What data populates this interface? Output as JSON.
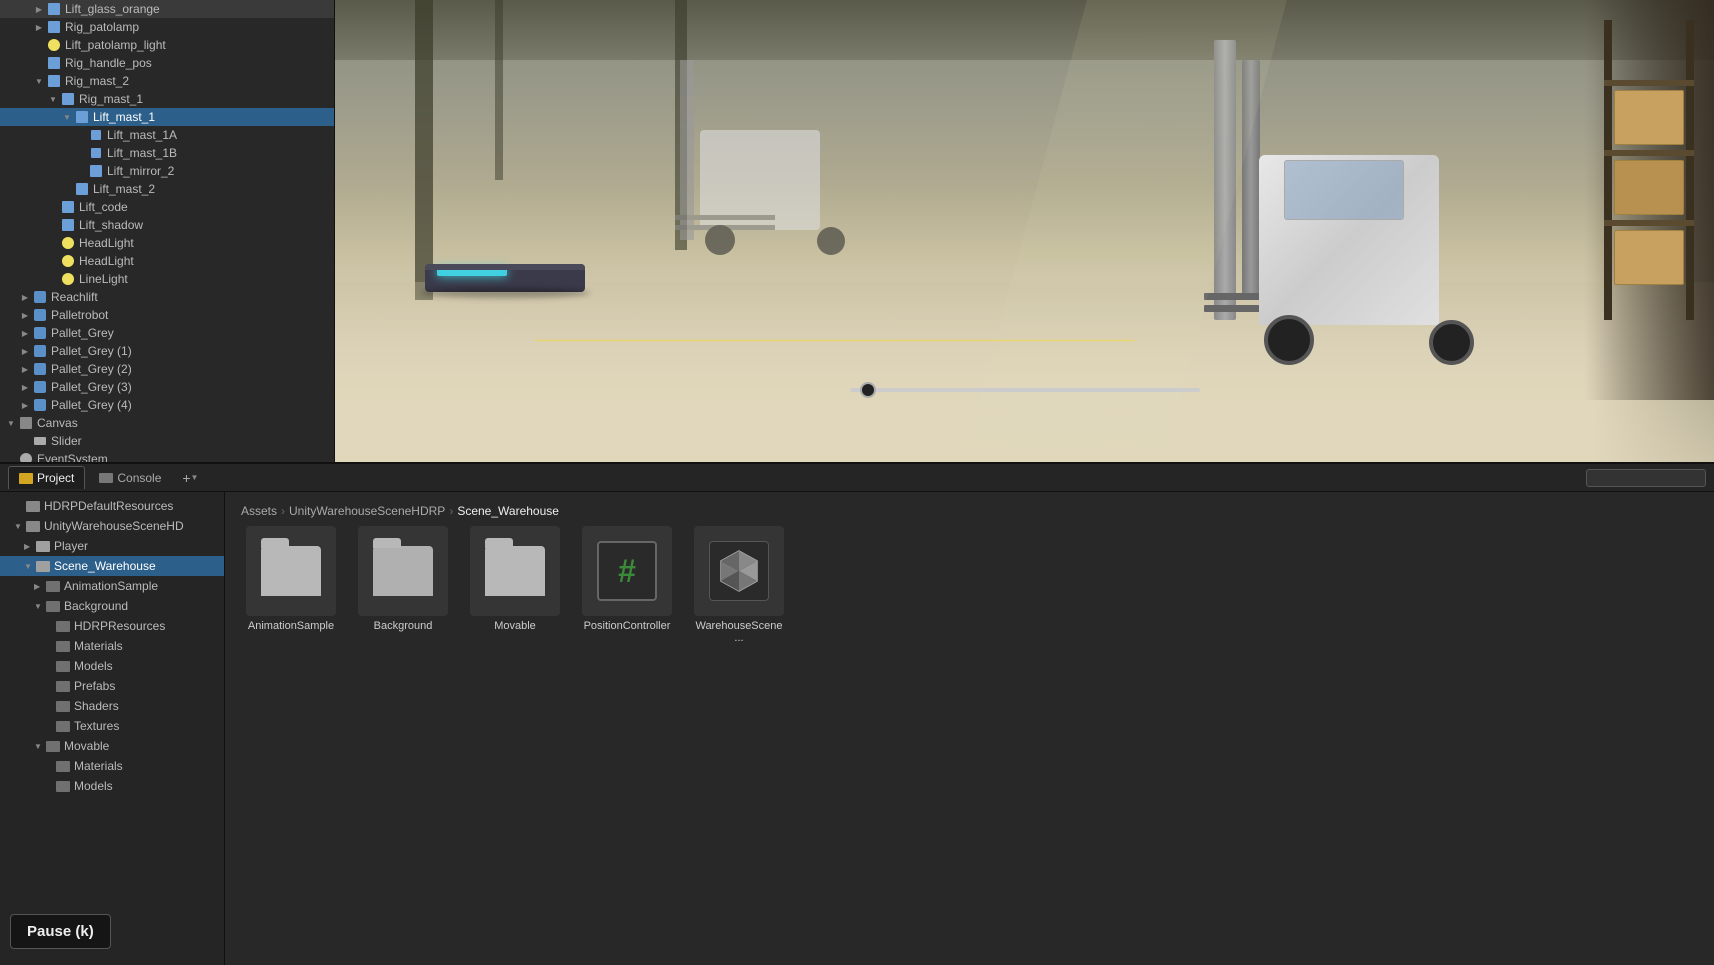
{
  "hierarchy": {
    "items": [
      {
        "id": "lift_glass_orange",
        "label": "Lift_glass_orange",
        "indent": 2,
        "icon": "cube",
        "expanded": false,
        "arrow": "right"
      },
      {
        "id": "rig_patolamp",
        "label": "Rig_patolamp",
        "indent": 2,
        "icon": "cube",
        "expanded": false,
        "arrow": "right"
      },
      {
        "id": "lift_patolamp_light",
        "label": "Lift_patolamp_light",
        "indent": 2,
        "icon": "light",
        "expanded": false,
        "arrow": null
      },
      {
        "id": "rig_handle_pos",
        "label": "Rig_handle_pos",
        "indent": 2,
        "icon": "cube",
        "expanded": false,
        "arrow": null
      },
      {
        "id": "rig_mast_2",
        "label": "Rig_mast_2",
        "indent": 2,
        "icon": "cube",
        "expanded": true,
        "arrow": "down"
      },
      {
        "id": "rig_mast_1",
        "label": "Rig_mast_1",
        "indent": 3,
        "icon": "cube",
        "expanded": true,
        "arrow": "down"
      },
      {
        "id": "lift_mast_1",
        "label": "Lift_mast_1",
        "indent": 4,
        "icon": "cube",
        "expanded": true,
        "arrow": "down",
        "selected": true
      },
      {
        "id": "lift_mast_1a",
        "label": "Lift_mast_1A",
        "indent": 5,
        "icon": "cube-small",
        "expanded": false,
        "arrow": null
      },
      {
        "id": "lift_mast_1b",
        "label": "Lift_mast_1B",
        "indent": 5,
        "icon": "cube-small",
        "expanded": false,
        "arrow": null
      },
      {
        "id": "lift_mirror_2",
        "label": "Lift_mirror_2",
        "indent": 5,
        "icon": "cube",
        "expanded": false,
        "arrow": null
      },
      {
        "id": "lift_mast_2",
        "label": "Lift_mast_2",
        "indent": 4,
        "icon": "cube",
        "expanded": false,
        "arrow": null
      },
      {
        "id": "lift_code",
        "label": "Lift_code",
        "indent": 3,
        "icon": "cube",
        "expanded": false,
        "arrow": null
      },
      {
        "id": "lift_shadow",
        "label": "Lift_shadow",
        "indent": 3,
        "icon": "cube",
        "expanded": false,
        "arrow": null
      },
      {
        "id": "headlight_1",
        "label": "HeadLight",
        "indent": 3,
        "icon": "light",
        "expanded": false,
        "arrow": null
      },
      {
        "id": "headlight_2",
        "label": "HeadLight",
        "indent": 3,
        "icon": "light",
        "expanded": false,
        "arrow": null
      },
      {
        "id": "linelight",
        "label": "LineLight",
        "indent": 3,
        "icon": "light",
        "expanded": false,
        "arrow": null
      },
      {
        "id": "reachlift",
        "label": "Reachlift",
        "indent": 1,
        "icon": "prefab",
        "expanded": false,
        "arrow": "right"
      },
      {
        "id": "palletrobot",
        "label": "Palletrobot",
        "indent": 1,
        "icon": "prefab",
        "expanded": false,
        "arrow": "right"
      },
      {
        "id": "pallet_grey",
        "label": "Pallet_Grey",
        "indent": 1,
        "icon": "prefab",
        "expanded": false,
        "arrow": "right"
      },
      {
        "id": "pallet_grey_1",
        "label": "Pallet_Grey (1)",
        "indent": 1,
        "icon": "prefab",
        "expanded": false,
        "arrow": "right"
      },
      {
        "id": "pallet_grey_2",
        "label": "Pallet_Grey (2)",
        "indent": 1,
        "icon": "prefab",
        "expanded": false,
        "arrow": "right"
      },
      {
        "id": "pallet_grey_3",
        "label": "Pallet_Grey (3)",
        "indent": 1,
        "icon": "prefab",
        "expanded": false,
        "arrow": "right"
      },
      {
        "id": "pallet_grey_4",
        "label": "Pallet_Grey (4)",
        "indent": 1,
        "icon": "prefab",
        "expanded": false,
        "arrow": "right"
      },
      {
        "id": "canvas",
        "label": "Canvas",
        "indent": 0,
        "icon": "canvas",
        "expanded": true,
        "arrow": "down"
      },
      {
        "id": "slider",
        "label": "Slider",
        "indent": 1,
        "icon": "slider",
        "expanded": false,
        "arrow": null
      },
      {
        "id": "eventsystem",
        "label": "EventSystem",
        "indent": 0,
        "icon": "event",
        "expanded": false,
        "arrow": null
      }
    ]
  },
  "tabs": {
    "project": "Project",
    "console": "Console",
    "add_icon": "+",
    "search_placeholder": ""
  },
  "asset_tree": {
    "items": [
      {
        "id": "hdrp_default",
        "label": "HDRPDefaultResources",
        "indent": 1,
        "expanded": false,
        "arrow": null
      },
      {
        "id": "unity_warehouse",
        "label": "UnityWarehouseSceneHD",
        "indent": 1,
        "expanded": true,
        "arrow": "down"
      },
      {
        "id": "player",
        "label": "Player",
        "indent": 2,
        "expanded": false,
        "arrow": "right"
      },
      {
        "id": "scene_warehouse",
        "label": "Scene_Warehouse",
        "indent": 2,
        "expanded": true,
        "arrow": "down",
        "selected": true
      },
      {
        "id": "animation_sample",
        "label": "AnimationSample",
        "indent": 3,
        "expanded": false,
        "arrow": "right"
      },
      {
        "id": "background",
        "label": "Background",
        "indent": 3,
        "expanded": true,
        "arrow": "down"
      },
      {
        "id": "hdrp_resources",
        "label": "HDRPResources",
        "indent": 4,
        "expanded": false,
        "arrow": null
      },
      {
        "id": "materials",
        "label": "Materials",
        "indent": 4,
        "expanded": false,
        "arrow": null
      },
      {
        "id": "models",
        "label": "Models",
        "indent": 4,
        "expanded": false,
        "arrow": null
      },
      {
        "id": "prefabs",
        "label": "Prefabs",
        "indent": 4,
        "expanded": false,
        "arrow": null
      },
      {
        "id": "shaders",
        "label": "Shaders",
        "indent": 4,
        "expanded": false,
        "arrow": null
      },
      {
        "id": "textures",
        "label": "Textures",
        "indent": 4,
        "expanded": false,
        "arrow": null
      },
      {
        "id": "movable",
        "label": "Movable",
        "indent": 3,
        "expanded": true,
        "arrow": "down"
      },
      {
        "id": "movable_materials",
        "label": "Materials",
        "indent": 4,
        "expanded": false,
        "arrow": null
      },
      {
        "id": "movable_models",
        "label": "Models",
        "indent": 4,
        "expanded": false,
        "arrow": null
      }
    ]
  },
  "breadcrumb": {
    "items": [
      "Assets",
      "UnityWarehouseSceneHDRP",
      "Scene_Warehouse"
    ]
  },
  "asset_grid": {
    "items": [
      {
        "id": "animation_sample",
        "label": "AnimationSample",
        "type": "folder"
      },
      {
        "id": "background",
        "label": "Background",
        "type": "folder"
      },
      {
        "id": "movable",
        "label": "Movable",
        "type": "folder"
      },
      {
        "id": "position_controller",
        "label": "PositionController",
        "type": "hash"
      },
      {
        "id": "warehouse_scene",
        "label": "WarehouseScene...",
        "type": "unity"
      }
    ]
  },
  "pause_button": {
    "label": "Pause (k)"
  }
}
